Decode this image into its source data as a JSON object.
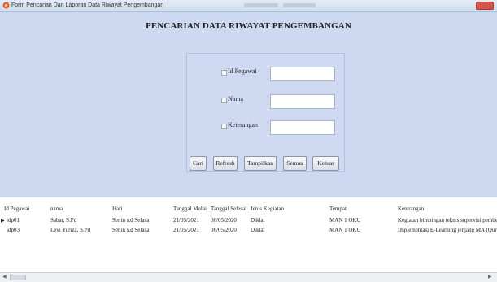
{
  "window": {
    "title": "Form Pencarian Dan Laporan Data Riwayat Pengembangan",
    "icon": "app-icon",
    "close_color": "#d4574a"
  },
  "form": {
    "heading": "PENCARIAN DATA RIWAYAT PENGEMBANGAN",
    "background": "#cdd8f1",
    "criteria": [
      {
        "label": "Id Pegawai",
        "value": "",
        "checked": false
      },
      {
        "label": "Nama",
        "value": "",
        "checked": false
      },
      {
        "label": "Keterangan",
        "value": "",
        "checked": false
      }
    ],
    "buttons": {
      "cari": "Cari",
      "refresh": "Refresh",
      "tampilkan": "Tampilkan",
      "semua": "Semua",
      "keluar": "Keluar"
    }
  },
  "grid": {
    "columns": [
      "Id Pegawai",
      "nama",
      "Hari",
      "Tanggal Mulai",
      "Tanggal Selesai",
      "Jenis Kegiatan",
      "Tempat",
      "Keterangan"
    ],
    "rows": [
      [
        "idp01",
        "Sabar, S.Pd",
        "Senin s.d Selasa",
        "21/05/2021",
        "06/05/2020",
        "Diklat",
        "MAN 1 OKU",
        "Kegiatan bimbingan teknis supervisi pembelaj"
      ],
      [
        "idp03",
        "Levi Yuriza, S.Pd",
        "Senin s.d Selasa",
        "21/05/2021",
        "06/05/2020",
        "Diklat",
        "MAN 1 OKU",
        "Implementasi E-Learning jenjang MA (Qur'an"
      ]
    ],
    "current_row_indicator": "▶"
  },
  "scrollbar": {
    "left_arrow": "◀",
    "right_arrow": "▶"
  }
}
